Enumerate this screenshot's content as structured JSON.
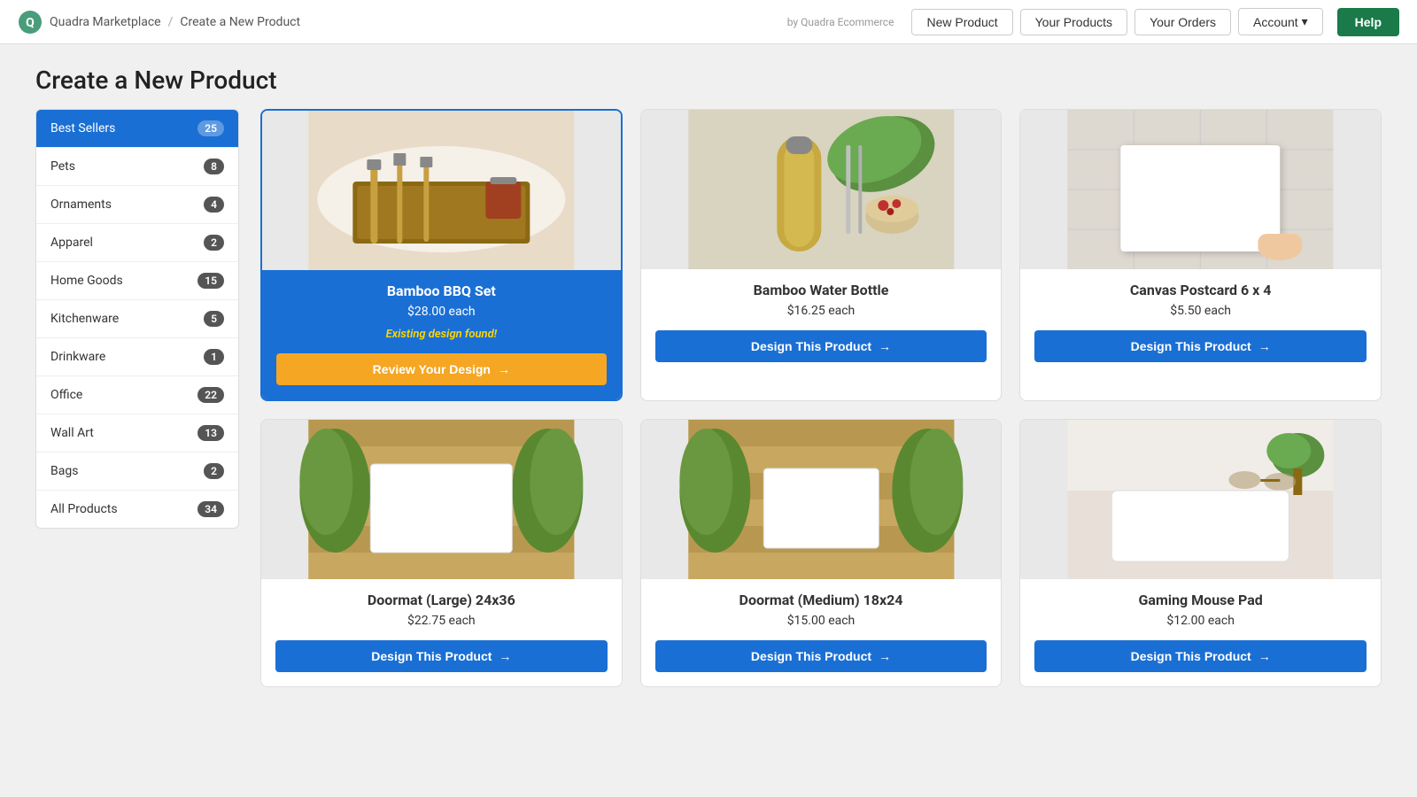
{
  "brand": {
    "name": "Quadra Marketplace",
    "separator": "/",
    "page": "Create a New Product",
    "credit": "by Quadra Ecommerce"
  },
  "nav": {
    "new_product": "New Product",
    "your_products": "Your Products",
    "your_orders": "Your Orders",
    "account": "Account",
    "help": "Help"
  },
  "page_title": "Create a New Product",
  "sidebar": {
    "items": [
      {
        "label": "Best Sellers",
        "count": "25",
        "active": true
      },
      {
        "label": "Pets",
        "count": "8",
        "active": false
      },
      {
        "label": "Ornaments",
        "count": "4",
        "active": false
      },
      {
        "label": "Apparel",
        "count": "2",
        "active": false
      },
      {
        "label": "Home Goods",
        "count": "15",
        "active": false
      },
      {
        "label": "Kitchenware",
        "count": "5",
        "active": false
      },
      {
        "label": "Drinkware",
        "count": "1",
        "active": false
      },
      {
        "label": "Office",
        "count": "22",
        "active": false
      },
      {
        "label": "Wall Art",
        "count": "13",
        "active": false
      },
      {
        "label": "Bags",
        "count": "2",
        "active": false
      },
      {
        "label": "All Products",
        "count": "34",
        "active": false
      }
    ]
  },
  "products": [
    {
      "id": "bamboo-bbq",
      "name": "Bamboo BBQ Set",
      "price": "$28.00 each",
      "featured": true,
      "existing_design": "Existing design found!",
      "btn_label": "Review Your Design",
      "btn_type": "review",
      "img_type": "bbq"
    },
    {
      "id": "bamboo-water",
      "name": "Bamboo Water Bottle",
      "price": "$16.25 each",
      "featured": false,
      "existing_design": null,
      "btn_label": "Design This Product",
      "btn_type": "design",
      "img_type": "water"
    },
    {
      "id": "canvas-postcard",
      "name": "Canvas Postcard 6 x 4",
      "price": "$5.50 each",
      "featured": false,
      "existing_design": null,
      "btn_label": "Design This Product",
      "btn_type": "design",
      "img_type": "postcard"
    },
    {
      "id": "doormat-large",
      "name": "Doormat (Large) 24x36",
      "price": "$22.75 each",
      "featured": false,
      "existing_design": null,
      "btn_label": "Design This Product",
      "btn_type": "design",
      "img_type": "doormat-lg"
    },
    {
      "id": "doormat-medium",
      "name": "Doormat (Medium) 18x24",
      "price": "$15.00 each",
      "featured": false,
      "existing_design": null,
      "btn_label": "Design This Product",
      "btn_type": "design",
      "img_type": "doormat-md"
    },
    {
      "id": "gaming-mousepad",
      "name": "Gaming Mouse Pad",
      "price": "$12.00 each",
      "featured": false,
      "existing_design": null,
      "btn_label": "Design This Product",
      "btn_type": "design",
      "img_type": "mousepad"
    }
  ],
  "icons": {
    "arrow_right": "→",
    "chevron_down": "▾"
  }
}
